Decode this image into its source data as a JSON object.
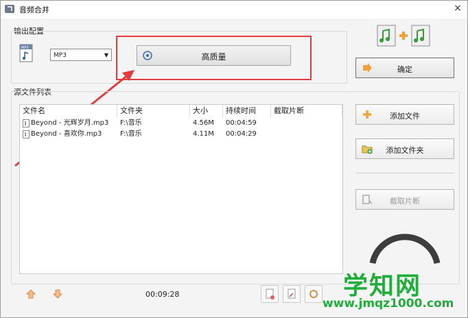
{
  "window": {
    "title": "音频合并",
    "close_label": "×"
  },
  "output": {
    "group_label": "输出配置",
    "format_value": "MP3",
    "quality_label": "高质量",
    "ok_label": "确定"
  },
  "source": {
    "group_label": "源文件列表",
    "columns": [
      "文件名",
      "文件夹",
      "大小",
      "持续时间",
      "截取片断"
    ],
    "rows": [
      {
        "name": "Beyond - 光辉岁月.mp3",
        "folder": "F:\\音乐",
        "size": "4.56M",
        "duration": "00:04:59",
        "clip": ""
      },
      {
        "name": "Beyond - 喜欢你.mp3",
        "folder": "F:\\音乐",
        "size": "4.11M",
        "duration": "00:04:29",
        "clip": ""
      }
    ],
    "total_time": "00:09:28"
  },
  "actions": {
    "add_file": "添加文件",
    "add_folder": "添加文件夹",
    "clip": "截取片断"
  },
  "watermark": {
    "big": "学知网",
    "small": "www.jmqz1000.com"
  },
  "colors": {
    "highlight": "#e23c3c",
    "watermark": "#1fae3a",
    "accent_orange": "#f2a23a"
  }
}
